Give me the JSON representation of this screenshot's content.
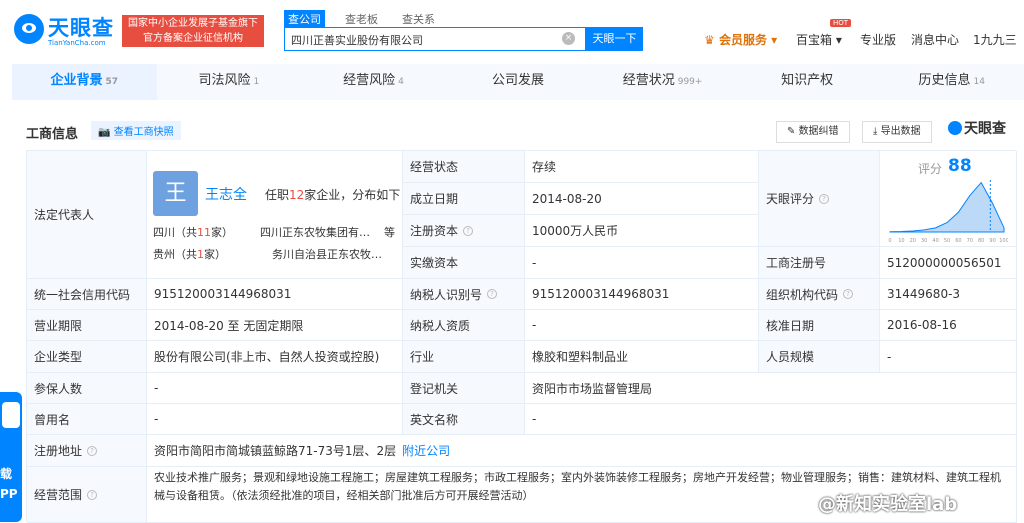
{
  "header": {
    "logo_name": "天眼查",
    "logo_sub": "TianYanCha.com",
    "badge_line1": "国家中小企业发展子基金旗下",
    "badge_line2": "官方备案企业征信机构",
    "search_tabs": [
      "查公司",
      "查老板",
      "查关系"
    ],
    "search_value": "四川正善实业股份有限公司",
    "search_button": "天眼一下",
    "vip": "会员服务",
    "baobao": "百宝箱",
    "hot": "HOT",
    "pro": "专业版",
    "messages": "消息中心",
    "user": "1九九三"
  },
  "tabs": [
    {
      "label": "企业背景",
      "count": "57"
    },
    {
      "label": "司法风险",
      "count": "1"
    },
    {
      "label": "经营风险",
      "count": "4"
    },
    {
      "label": "公司发展",
      "count": ""
    },
    {
      "label": "经营状况",
      "count": "999+"
    },
    {
      "label": "知识产权",
      "count": ""
    },
    {
      "label": "历史信息",
      "count": "14"
    }
  ],
  "section": {
    "title": "工商信息",
    "snapshot": "查看工商快照",
    "correct": "数据纠错",
    "export": "导出数据",
    "watermark": "天眼查"
  },
  "legal_rep": {
    "label": "法定代表人",
    "avatar": "王",
    "name": "王志全",
    "note_prefix": "任职",
    "note_count": "12",
    "note_suffix": "家企业，分布如下",
    "row1_region": "四川（共",
    "row1_count": "11",
    "row1_unit": "家）",
    "row1_company": "四川正东农牧集团有…",
    "row1_more": "等",
    "row2_region": "贵州（共",
    "row2_count": "1",
    "row2_unit": "家）",
    "row2_company": "务川自治县正东农牧…"
  },
  "info": {
    "status_label": "经营状态",
    "status": "存续",
    "founded_label": "成立日期",
    "founded": "2014-08-20",
    "capital_label": "注册资本",
    "capital": "10000万人民币",
    "paid_label": "实缴资本",
    "paid": "-",
    "score_label": "天眼评分",
    "score_word": "评分",
    "score": "88",
    "reg_no_label": "工商注册号",
    "reg_no": "512000000056501",
    "credit_label": "统一社会信用代码",
    "credit": "915120003144968031",
    "taxpayer_label": "纳税人识别号",
    "taxpayer": "915120003144968031",
    "org_label": "组织机构代码",
    "org": "31449680-3",
    "term_label": "营业期限",
    "term": "2014-08-20 至 无固定期限",
    "tax_quality_label": "纳税人资质",
    "tax_quality": "-",
    "approve_label": "核准日期",
    "approve": "2016-08-16",
    "type_label": "企业类型",
    "type": "股份有限公司(非上市、自然人投资或控股)",
    "industry_label": "行业",
    "industry": "橡胶和塑料制品业",
    "staff_label": "人员规模",
    "staff": "-",
    "insured_label": "参保人数",
    "insured": "-",
    "authority_label": "登记机关",
    "authority": "资阳市市场监督管理局",
    "former_label": "曾用名",
    "former": "-",
    "en_label": "英文名称",
    "en": "-",
    "address_label": "注册地址",
    "address": "资阳市简阳市简城镇蓝鲸路71-73号1层、2层",
    "nearby": "附近公司",
    "scope_label": "经营范围",
    "scope": "农业技术推广服务；景观和绿地设施工程施工；房屋建筑工程服务；市政工程服务；室内外装饰装修工程服务；房地产开发经营；物业管理服务；销售：建筑材料、建筑工程机械与设备租赁。（依法须经批准的项目，经相关部门批准后方可开展经营活动）"
  },
  "chart_data": {
    "type": "area",
    "x": [
      0,
      10,
      20,
      30,
      40,
      50,
      60,
      70,
      80,
      90,
      100
    ],
    "tick_labels": [
      "0",
      "10",
      "20",
      "30",
      "40",
      "50",
      "60",
      "70",
      "80",
      "90",
      "100"
    ],
    "values": [
      0.5,
      1,
      2,
      4,
      8,
      18,
      38,
      70,
      95,
      55,
      8
    ],
    "marker": 88,
    "ylim": [
      0,
      100
    ]
  },
  "side_app": "载\nPP",
  "weibo": "@新知实验室lab",
  "colors": {
    "accent": "#0084ff",
    "red": "#e84e40",
    "vip": "#e0720b",
    "label_bg": "#f6f9fd"
  }
}
